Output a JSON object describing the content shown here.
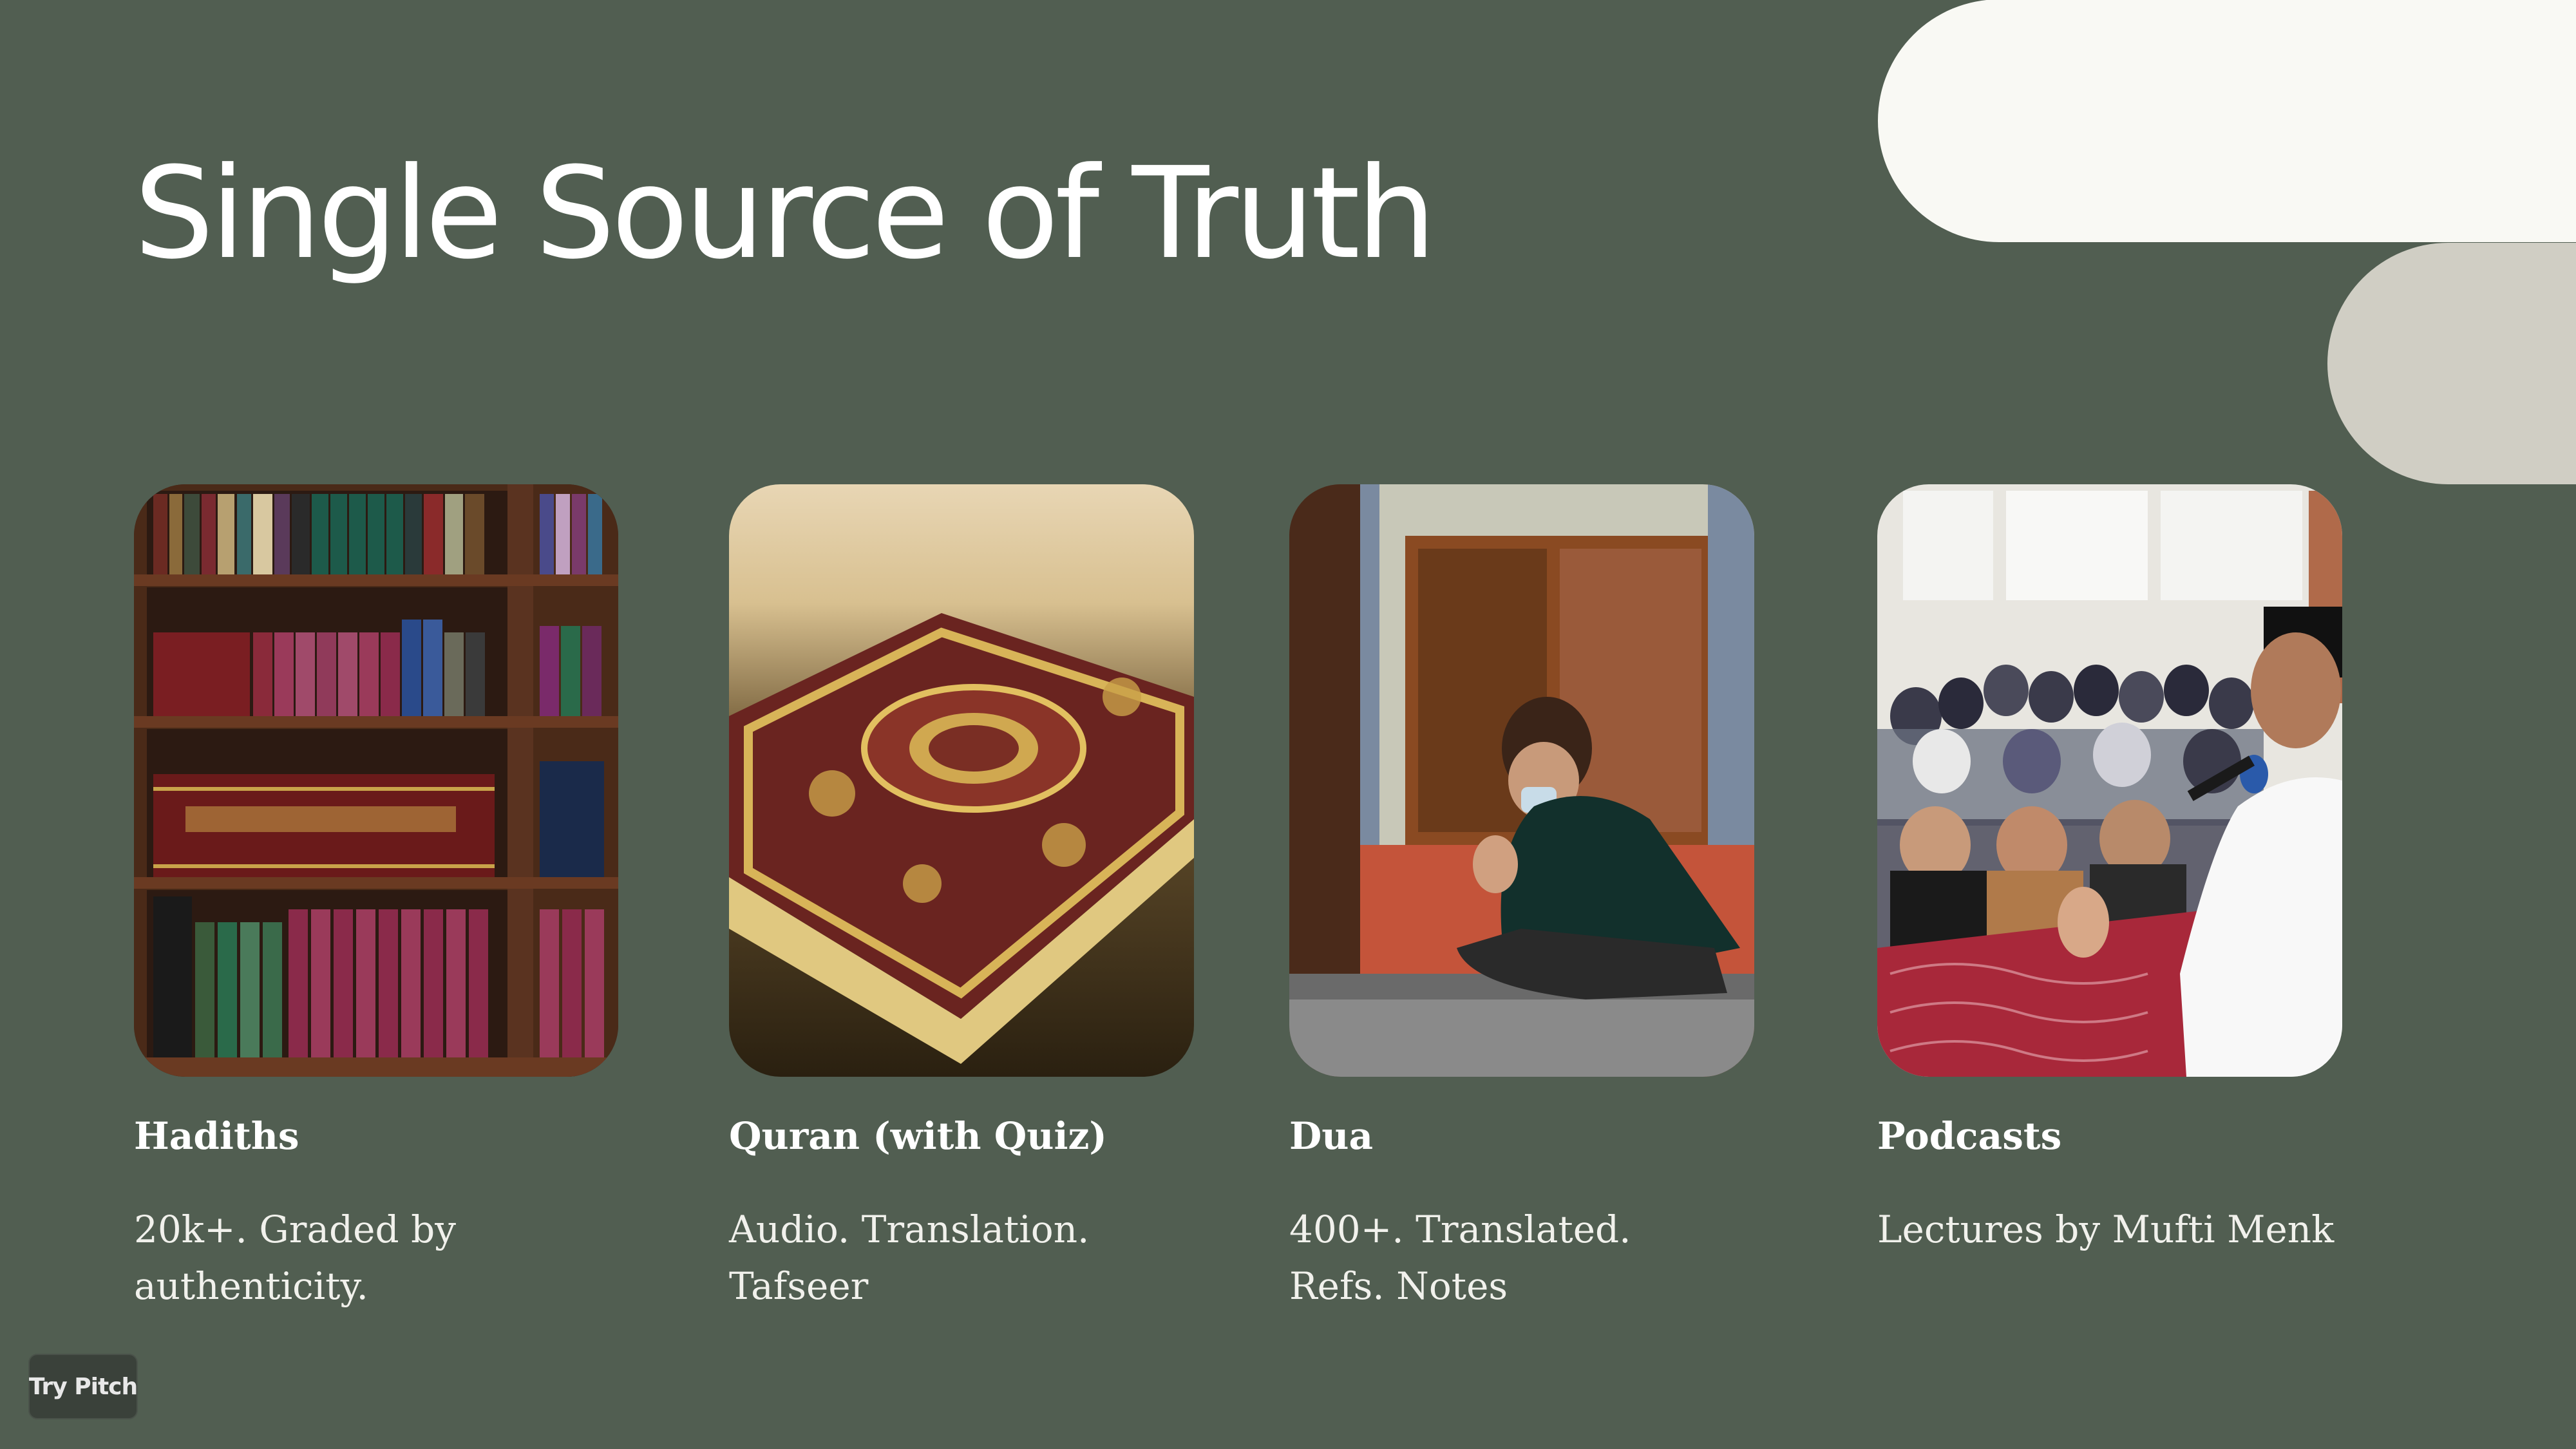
{
  "slide": {
    "title": "Single Source of Truth",
    "background_color": "#515e51",
    "accent_light": "#f9f9f4",
    "accent_muted": "#d0cec4"
  },
  "cards": [
    {
      "label": "Hadiths",
      "description": "20k+. Graded by authenticity.",
      "image": "bookshelf-photo"
    },
    {
      "label": "Quran (with Quiz)",
      "description": "Audio. Translation. Tafseer",
      "image": "quran-book-photo"
    },
    {
      "label": "Dua",
      "description": "400+. Translated. Refs. Notes",
      "image": "man-praying-photo"
    },
    {
      "label": "Podcasts",
      "description": "Lectures by Mufti Menk",
      "image": "lecture-audience-photo"
    }
  ],
  "footer": {
    "try_pitch_label": "Try Pitch"
  }
}
